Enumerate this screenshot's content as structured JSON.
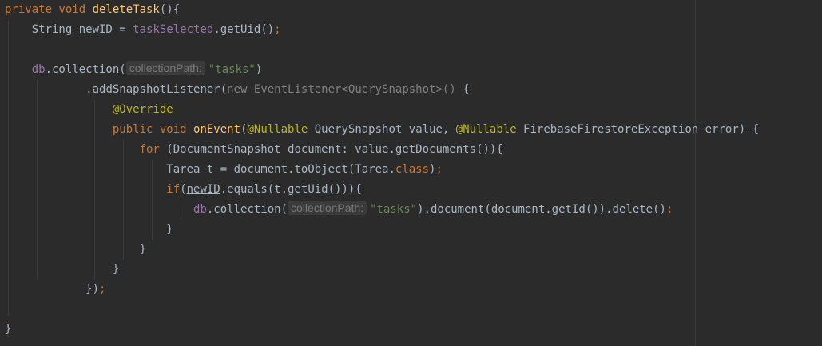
{
  "editor": {
    "theme_colors": {
      "background": "#2b2b2b",
      "keyword": "#cc7832",
      "method": "#ffc66d",
      "field": "#9876aa",
      "string": "#6a8759",
      "annotation": "#bbb529",
      "text": "#a9b7c6"
    },
    "hints": {
      "collection_path": "collectionPath:"
    },
    "l1": {
      "kw": "private void ",
      "fn": "deleteTask",
      "rest": "(){"
    },
    "l2": {
      "a": "String newID = ",
      "field": "taskSelected",
      "b": ".getUid()",
      "semi": ";"
    },
    "l4": {
      "field": "db",
      "a": ".collection(",
      "str": "\"tasks\"",
      "b": ")"
    },
    "l5": {
      "a": ".addSnapshotListener(",
      "dim": "new EventListener<QuerySnapshot>()",
      "b": " {"
    },
    "l6": {
      "ann": "@Override"
    },
    "l7": {
      "kw": "public void ",
      "fn": "onEvent",
      "a": "(",
      "ann1": "@Nullable",
      "b": " QuerySnapshot value, ",
      "ann2": "@Nullable",
      "c": " FirebaseFirestoreException error) {"
    },
    "l8": {
      "kw": "for",
      "a": " (DocumentSnapshot document: value.getDocuments()){"
    },
    "l9": {
      "a": "Tarea t = document.toObject(Tarea.",
      "kw": "class",
      "b": ")",
      "semi": ";"
    },
    "l10": {
      "kw": "if",
      "a": "(",
      "ul": "newID",
      "b": ".equals(t.getUid())){"
    },
    "l11": {
      "field": "db",
      "a": ".collection(",
      "str": "\"tasks\"",
      "b": ").document(document.getId()).delete()",
      "semi": ";"
    },
    "l12": {
      "a": "}"
    },
    "l13": {
      "a": "}"
    },
    "l14": {
      "a": "}"
    },
    "l15": {
      "a": "})",
      "semi": ";"
    },
    "l17": {
      "a": "}"
    }
  }
}
